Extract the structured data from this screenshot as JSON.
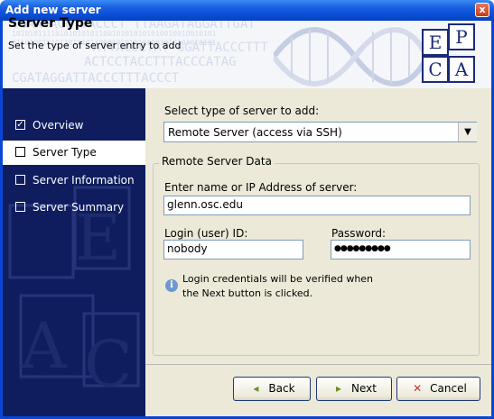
{
  "window": {
    "title": "Add new server",
    "close_glyph": "x"
  },
  "header": {
    "title": "Server Type",
    "subtitle": "Set the type of server entry to add",
    "logo_letters": [
      "E",
      "P",
      "C",
      "A"
    ]
  },
  "sidebar": {
    "items": [
      {
        "label": "Overview",
        "checked": true,
        "active": false
      },
      {
        "label": "Server Type",
        "checked": false,
        "active": true
      },
      {
        "label": "Server Information",
        "checked": false,
        "active": false
      },
      {
        "label": "Server Summary",
        "checked": false,
        "active": false
      }
    ],
    "checked_glyph": "✓"
  },
  "form": {
    "select_label": "Select type of server to add:",
    "select_value": "Remote Server (access via SSH)",
    "group_title": "Remote Server Data",
    "host_label": "Enter name or IP Address of server:",
    "host_value": "glenn.osc.edu",
    "login_label": "Login (user) ID:",
    "login_value": "nobody",
    "password_label": "Password:",
    "password_value": "●●●●●●●●●",
    "info_text_line1": "Login credentials will be verified when",
    "info_text_line2": "the Next button is clicked."
  },
  "buttons": {
    "back": "Back",
    "next": "Next",
    "cancel": "Cancel"
  },
  "colors": {
    "titlebar": "#0a4fd6",
    "sidebar": "#0f1d5e",
    "panel": "#ece9d8",
    "logo": "#1a2a78"
  }
}
